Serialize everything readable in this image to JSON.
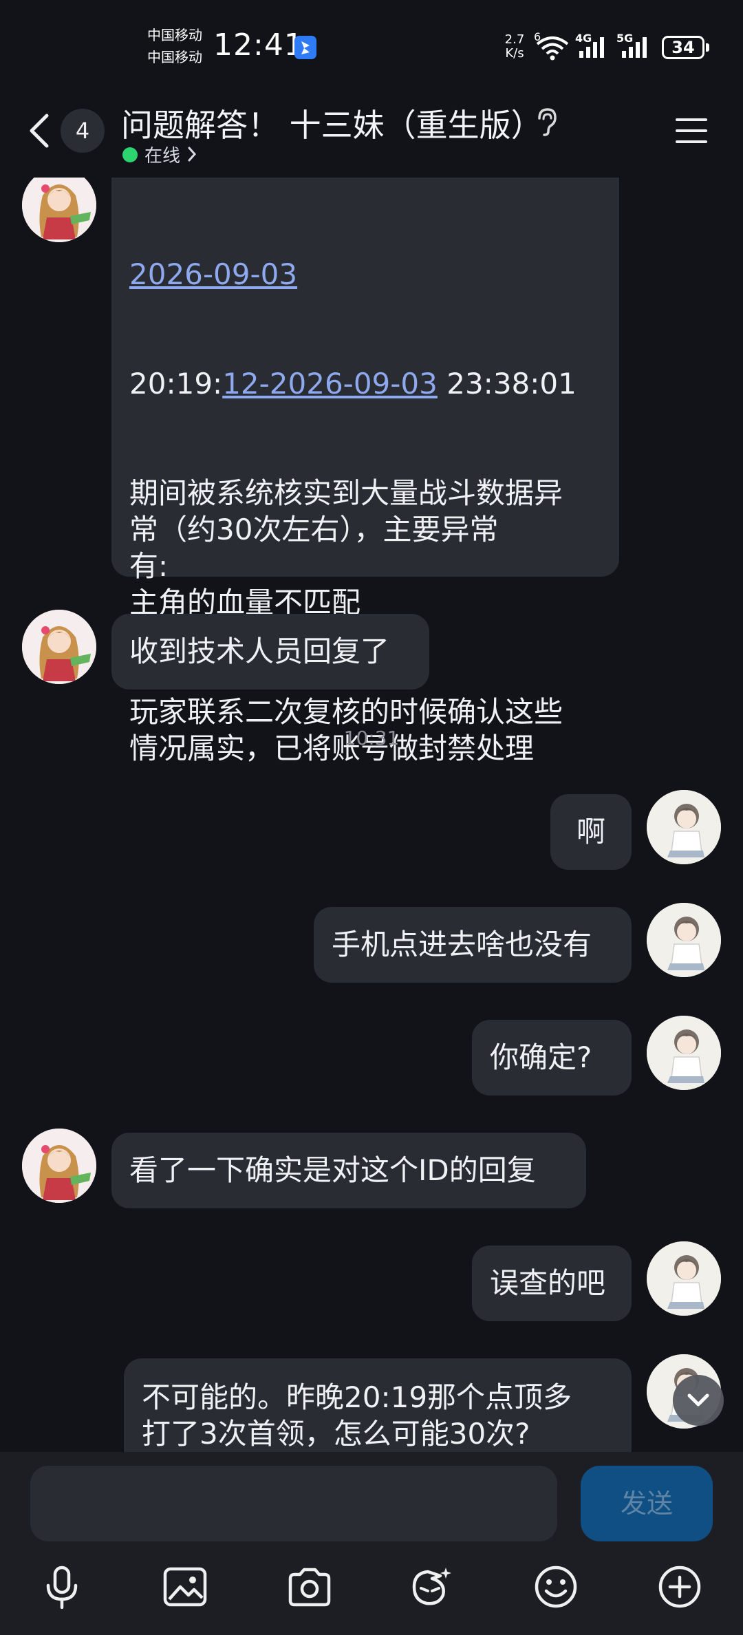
{
  "status_bar": {
    "carrier_1": "中国移动",
    "carrier_2": "中国移动",
    "time": "12:41",
    "net_speed_value": "2.7",
    "net_speed_unit": "K/s",
    "wifi_label": "6",
    "cell1_label": "4G",
    "cell2_label": "5G",
    "battery": "34"
  },
  "header": {
    "unread_count": "4",
    "title": "问题解答！ 十三妹（重生版）",
    "status": "在线"
  },
  "messages": {
    "m1": {
      "date_link_1": "2026-09-03",
      "line2_prefix": "20:19:",
      "date_link_2": "12-2026-09-03",
      "line2_suffix": " 23:38:01",
      "rest": "期间被系统核实到大量战斗数据异\n常（约30次左右），主要异常\n有:\n主角的血量不匹配\n帧的数量不匹配\n主角的伤害不匹配\n玩家联系二次复核的时候确认这些\n情况属实，已将账号做封禁处理"
    },
    "m2": "收到技术人员回复了",
    "timestamp": "10:31",
    "m3": "啊",
    "m4": "手机点进去啥也没有",
    "m5": "你确定?",
    "m6": "看了一下确实是对这个ID的回复",
    "m7": "误查的吧",
    "m8": "不可能的。昨晚20:19那个点顶多\n打了3次首领，怎么可能30次?"
  },
  "input": {
    "placeholder": "",
    "send_label": "发送"
  },
  "toolbar_icons": [
    "microphone-icon",
    "image-icon",
    "camera-icon",
    "sticker-icon",
    "emoji-icon",
    "plus-icon"
  ]
}
